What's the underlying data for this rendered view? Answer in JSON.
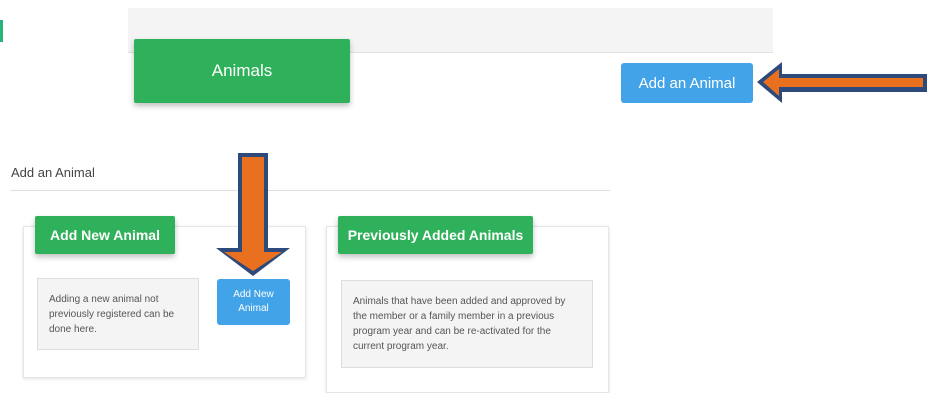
{
  "header": {
    "title": "Animals"
  },
  "toolbar": {
    "add_animal_label": "Add an Animal"
  },
  "section": {
    "title": "Add an Animal"
  },
  "cards": {
    "new_animal": {
      "title": "Add New Animal",
      "description": "Adding a new animal not previously registered can be done here.",
      "button_label": "Add New Animal"
    },
    "previous_animals": {
      "title": "Previously Added Animals",
      "description": "Animals that have been added and approved by the member or a family member in a previous program year and can be re-activated for the current program year."
    }
  },
  "colors": {
    "header_green": "#2eb15a",
    "button_blue": "#42a3e8",
    "annotation_arrow_fill": "#e8701f",
    "annotation_arrow_outline": "#2d4a7a"
  },
  "icons": {
    "annotation_arrows": [
      "arrow-left-icon",
      "arrow-down-icon"
    ]
  }
}
